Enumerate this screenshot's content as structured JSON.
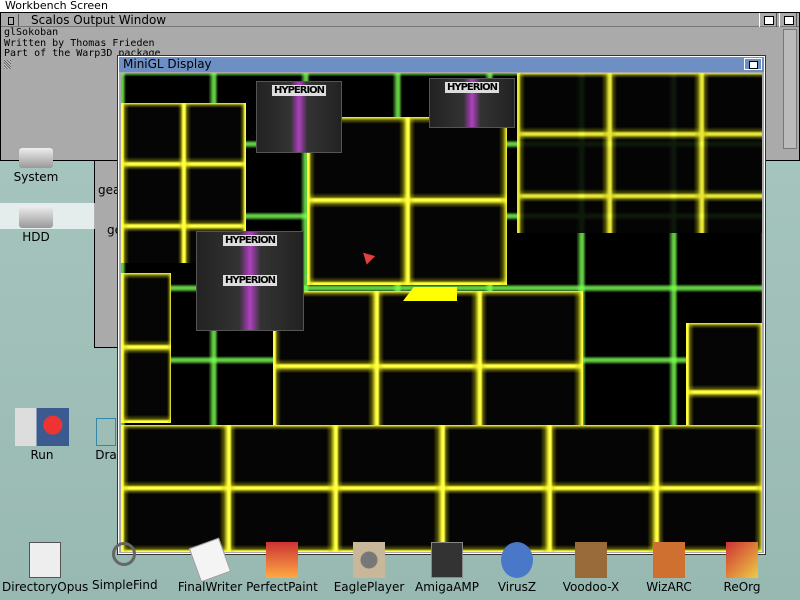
{
  "screen": {
    "title": "Workbench Screen"
  },
  "output_window": {
    "title": "Scalos Output Window",
    "lines": [
      "glSokoban",
      "Written by Thomas Frieden",
      "Part of the Warp3D package"
    ]
  },
  "background_window": {
    "lines": [
      "gea",
      "ge"
    ]
  },
  "desktop_icons": [
    {
      "label": "System"
    },
    {
      "label": "HDD"
    },
    {
      "label": "Run"
    },
    {
      "label": "Dra"
    }
  ],
  "minigl_window": {
    "title": "MiniGL Display",
    "crate_label": "HYPERION",
    "colors": {
      "title": "#6d8fc4",
      "grid_glow": "#ffff40",
      "floor_glow": "#78ff50",
      "player": "#ffff00"
    }
  },
  "dock": [
    {
      "label": "DirectoryOpus"
    },
    {
      "label": "SimpleFind"
    },
    {
      "label": "FinalWriter"
    },
    {
      "label": "PerfectPaint"
    },
    {
      "label": "EaglePlayer"
    },
    {
      "label": "AmigaAMP"
    },
    {
      "label": "VirusZ"
    },
    {
      "label": "Voodoo-X"
    },
    {
      "label": "WizARC"
    },
    {
      "label": "ReOrg"
    }
  ]
}
